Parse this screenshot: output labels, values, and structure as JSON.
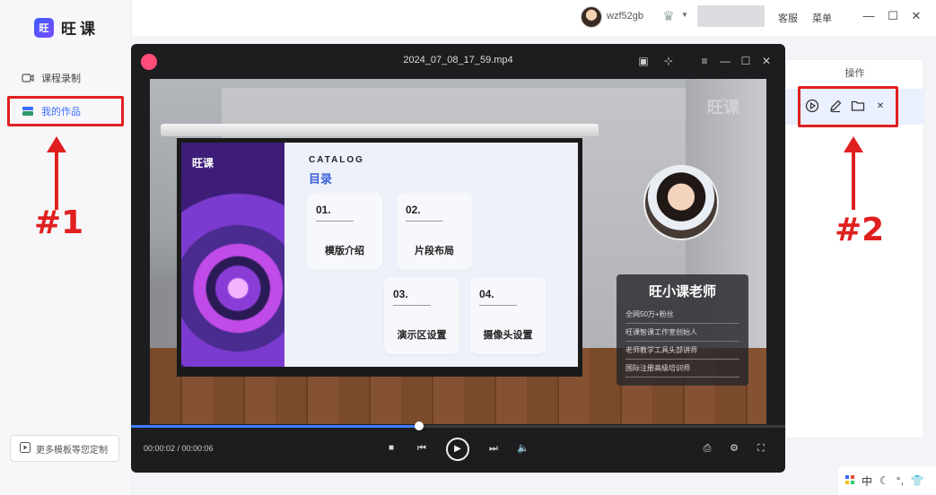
{
  "app": {
    "logo_mark": "旺",
    "logo_text": "旺课"
  },
  "sidebar": {
    "items": [
      {
        "label": "课程录制",
        "icon": "video-record-icon"
      },
      {
        "label": "我的作品",
        "icon": "folder-stack-icon",
        "active": true
      }
    ],
    "bottom_button": "更多模板等您定制"
  },
  "topbar": {
    "username": "wzf52gb",
    "links": [
      "客服",
      "菜单"
    ]
  },
  "annotations": {
    "label1": "#1",
    "label2": "#2",
    "color": "#e02020"
  },
  "right_panel": {
    "header": "操作",
    "actions": [
      "play-icon",
      "edit-icon",
      "folder-icon",
      "close-icon"
    ]
  },
  "player": {
    "title": "2024_07_08_17_59.mp4",
    "time": "00:00:02 / 00:00:06",
    "progress": 0.44,
    "accent": "#3f7bff",
    "slide": {
      "logo": "旺课",
      "catalog": "CATALOG",
      "heading": "目录",
      "cards": [
        {
          "num": "01.",
          "label": "模版介绍"
        },
        {
          "num": "02.",
          "label": "片段布局"
        },
        {
          "num": "03.",
          "label": "演示区设置"
        },
        {
          "num": "04.",
          "label": "摄像头设置"
        }
      ],
      "watermark": "旺课"
    },
    "teacher": {
      "name": "旺小课老师",
      "lines": [
        "全网50万+粉丝",
        "旺课智课工作室创始人",
        "老师教学工具头部讲师",
        "国际注册高级培训师"
      ]
    }
  },
  "ime": {
    "lang": "中"
  }
}
